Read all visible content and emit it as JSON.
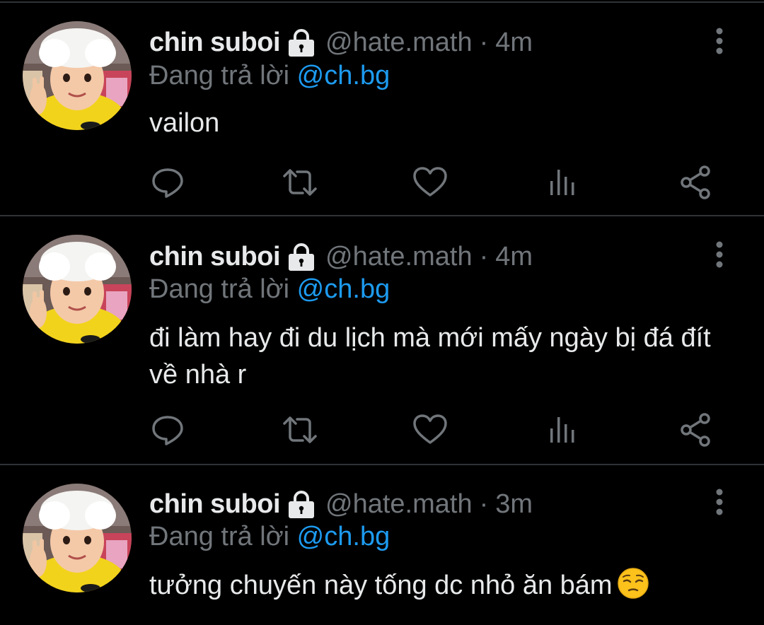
{
  "colors": {
    "background": "#000000",
    "primary_text": "#e7e9ea",
    "secondary_text": "#71767b",
    "mention": "#1d9bf0",
    "divider": "#2f3336"
  },
  "tweets": [
    {
      "name": "chin suboi",
      "handle": "@hate.math",
      "separator": "·",
      "time": "4m",
      "reply_prefix": "Đang trả lời",
      "reply_mention": "@ch.bg",
      "text": "vailon",
      "has_emoji": false
    },
    {
      "name": "chin suboi",
      "handle": "@hate.math",
      "separator": "·",
      "time": "4m",
      "reply_prefix": "Đang trả lời",
      "reply_mention": "@ch.bg",
      "text": "đi làm hay đi du lịch mà mới mấy ngày bị đá đít về nhà r",
      "has_emoji": false
    },
    {
      "name": "chin suboi",
      "handle": "@hate.math",
      "separator": "·",
      "time": "3m",
      "reply_prefix": "Đang trả lời",
      "reply_mention": "@ch.bg",
      "text": "tưởng chuyến này tống dc nhỏ ăn bám",
      "has_emoji": true,
      "emoji": "pensive-face"
    }
  ],
  "icons": {
    "verified_lock": "lock-icon",
    "more": "more-vertical-icon",
    "reply": "reply-icon",
    "retweet": "retweet-icon",
    "like": "heart-icon",
    "views": "analytics-icon",
    "share": "share-icon"
  }
}
